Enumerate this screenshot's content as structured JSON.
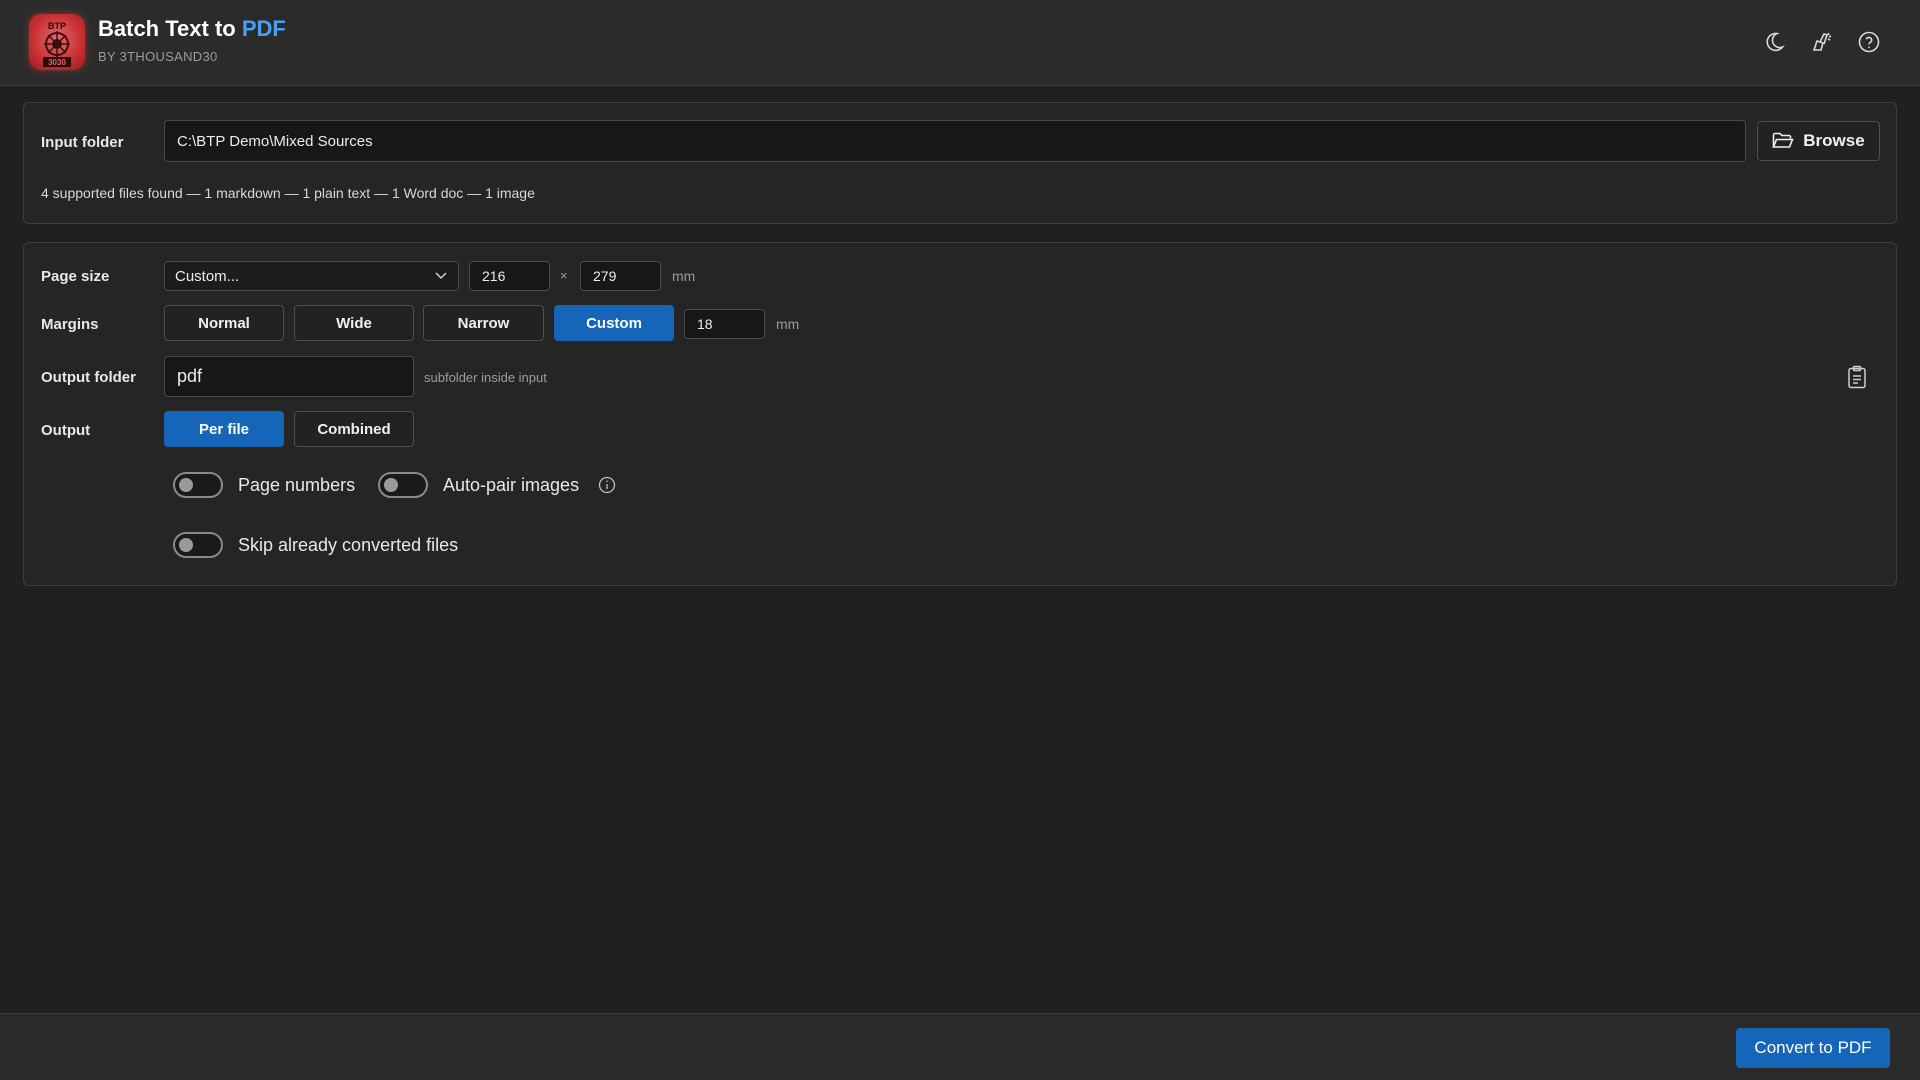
{
  "header": {
    "title_main": "Batch Text to ",
    "title_accent": "PDF",
    "subtitle": "BY 3THOUSAND30",
    "logo": {
      "top_text": "BTP",
      "bottom_text": "3030",
      "icon": "app-logo"
    },
    "icons": [
      "moon-icon",
      "clean-icon",
      "help-icon"
    ]
  },
  "input_panel": {
    "label": "Input folder",
    "path_value": "C:\\BTP Demo\\Mixed Sources",
    "browse_label": "Browse",
    "summary": "4 supported files found — 1 markdown — 1 plain text — 1 Word doc — 1 image"
  },
  "settings": {
    "page_size": {
      "label": "Page size",
      "selected": "Custom...",
      "width": "216",
      "times": "×",
      "height": "279",
      "unit": "mm"
    },
    "margins": {
      "label": "Margins",
      "options": [
        "Normal",
        "Wide",
        "Narrow",
        "Custom"
      ],
      "selected": "Custom",
      "custom_value": "18",
      "unit": "mm"
    },
    "output_folder": {
      "label": "Output folder",
      "value": "pdf",
      "hint": "subfolder inside input"
    },
    "output": {
      "label": "Output",
      "options": [
        "Per file",
        "Combined"
      ],
      "selected": "Per file"
    },
    "toggles": {
      "page_numbers": {
        "label": "Page numbers",
        "on": false
      },
      "auto_pair": {
        "label": "Auto-pair images",
        "on": false
      },
      "skip_converted": {
        "label": "Skip already converted files",
        "on": false
      }
    }
  },
  "footer": {
    "convert_label": "Convert to PDF"
  },
  "colors": {
    "accent": "#1565b8",
    "title_accent": "#4aa0f0",
    "background": "#202020",
    "panel": "#252525",
    "logo": "#c72f33"
  }
}
